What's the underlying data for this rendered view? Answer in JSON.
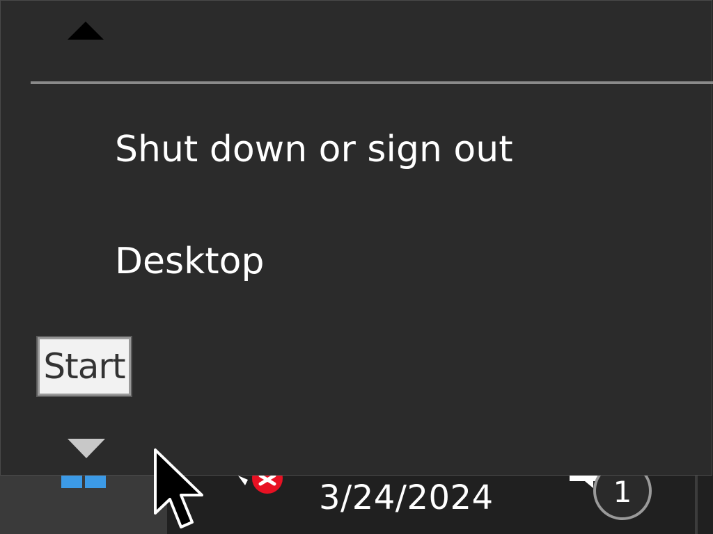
{
  "taskbar": {
    "clock_date": "3/24/2024",
    "notification_count": "1",
    "colors": {
      "background": "#202020",
      "start_zone": "#3a3a3a",
      "windows_blue": "#3c9ae6",
      "error_red": "#e81123"
    },
    "icons": {
      "start": "windows-logo-icon",
      "network_status": "network-error-icon",
      "notifications": "notification-badge-icon"
    }
  },
  "flyout": {
    "items": [
      {
        "label": "Shut down or sign out"
      },
      {
        "label": "Desktop"
      }
    ],
    "tooltip": "Start",
    "icons": {
      "scroll_up": "scroll-up-arrow-icon",
      "scroll_down": "scroll-down-arrow-icon"
    },
    "colors": {
      "background": "#2b2b2b",
      "separator": "#8a8a8a",
      "text": "#ffffff"
    }
  }
}
